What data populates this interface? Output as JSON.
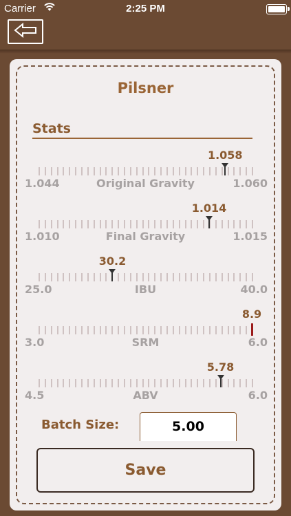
{
  "status_bar": {
    "carrier": "Carrier",
    "time": "2:25 PM"
  },
  "header": {
    "back_icon": "back-arrow-icon"
  },
  "recipe": {
    "name": "Pilsner"
  },
  "stats": {
    "heading": "Stats",
    "sliders": [
      {
        "name": "Original Gravity",
        "min": "1.044",
        "max": "1.060",
        "value": "1.058",
        "min_value": 1.044,
        "max_value": 1.06,
        "current": 1.058,
        "out_of_range": false
      },
      {
        "name": "Final Gravity",
        "min": "1.010",
        "max": "1.015",
        "value": "1.014",
        "min_value": 1.01,
        "max_value": 1.015,
        "current": 1.014,
        "out_of_range": false
      },
      {
        "name": "IBU",
        "min": "25.0",
        "max": "40.0",
        "value": "30.2",
        "min_value": 25.0,
        "max_value": 40.0,
        "current": 30.2,
        "out_of_range": false
      },
      {
        "name": "SRM",
        "min": "3.0",
        "max": "6.0",
        "value": "8.9",
        "min_value": 3.0,
        "max_value": 6.0,
        "current": 8.9,
        "out_of_range": true
      },
      {
        "name": "ABV",
        "min": "4.5",
        "max": "6.0",
        "value": "5.78",
        "min_value": 4.5,
        "max_value": 6.0,
        "current": 5.78,
        "out_of_range": false
      }
    ]
  },
  "batch": {
    "label": "Batch Size:",
    "value": "5.00"
  },
  "actions": {
    "save_label": "Save"
  },
  "colors": {
    "accent": "#8a5a30",
    "background": "#6b4a33",
    "card": "#f2eeee",
    "alert": "#9b1a1a"
  }
}
